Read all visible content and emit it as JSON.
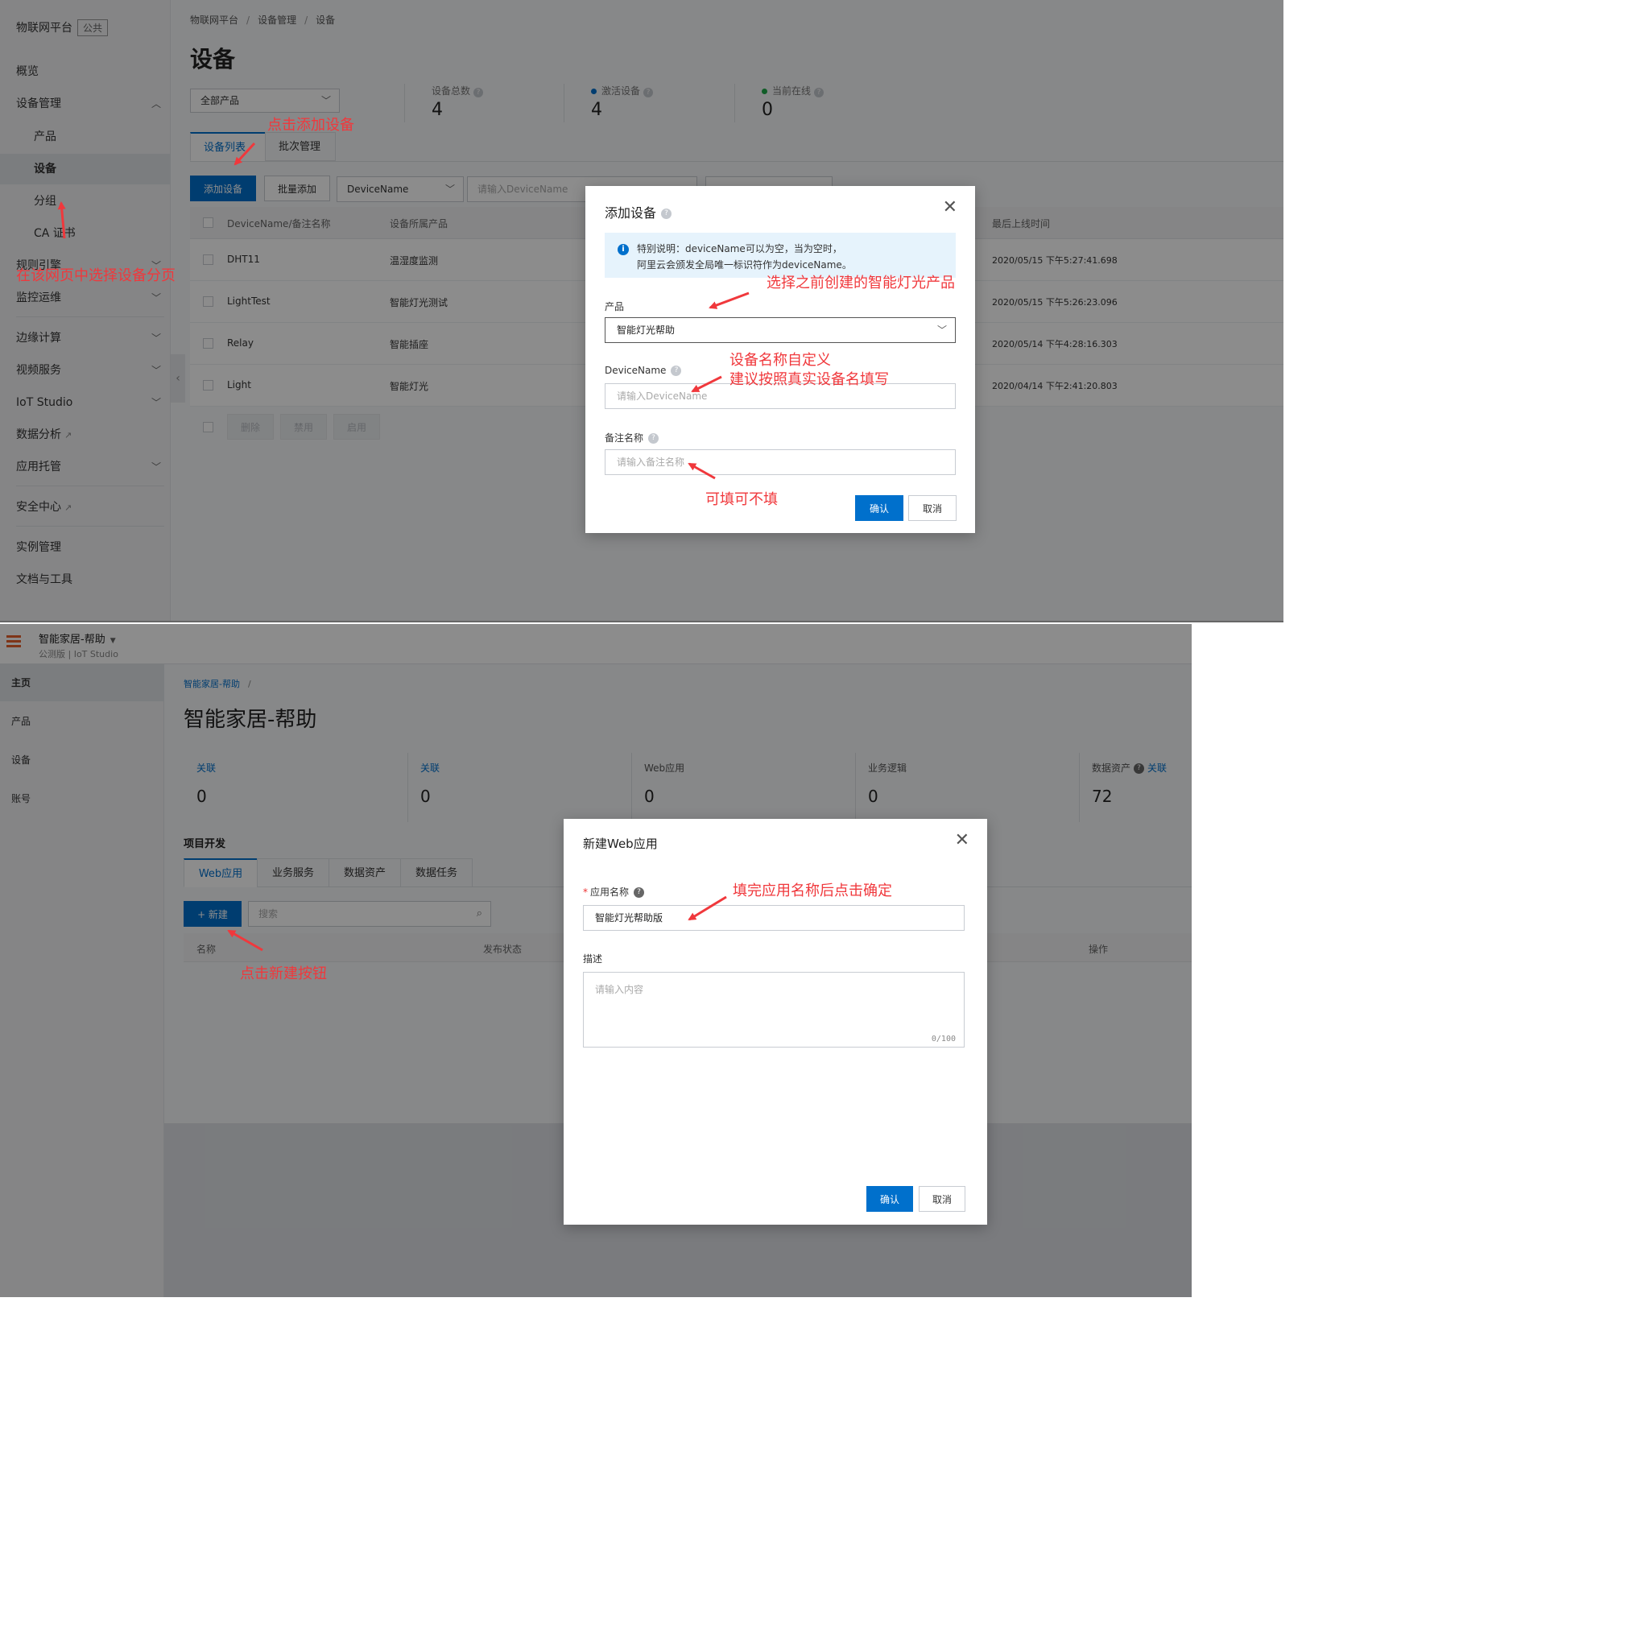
{
  "panel1": {
    "sidebar": {
      "brand": "物联网平台",
      "brand_tag": "公共",
      "items": [
        {
          "label": "概览"
        },
        {
          "label": "设备管理"
        },
        {
          "label": "产品"
        },
        {
          "label": "设备"
        },
        {
          "label": "分组"
        },
        {
          "label": "CA 证书"
        },
        {
          "label": "规则引擎"
        },
        {
          "label": "监控运维"
        },
        {
          "label": "边缘计算"
        },
        {
          "label": "视频服务"
        },
        {
          "label": "IoT Studio"
        },
        {
          "label": "数据分析"
        },
        {
          "label": "应用托管"
        },
        {
          "label": "安全中心"
        },
        {
          "label": "实例管理"
        },
        {
          "label": "文档与工具"
        }
      ]
    },
    "breadcrumb": [
      "物联网平台",
      "设备管理",
      "设备"
    ],
    "page_title": "设备",
    "product_filter": "全部产品",
    "stats": [
      {
        "label": "设备总数",
        "value": "4",
        "dot": ""
      },
      {
        "label": "激活设备",
        "value": "4",
        "dot": "#0070cc"
      },
      {
        "label": "当前在线",
        "value": "0",
        "dot": "#1fa94a"
      }
    ],
    "tabs": [
      "设备列表",
      "批次管理"
    ],
    "toolbar": {
      "add": "添加设备",
      "batch_add": "批量添加",
      "search_field": "DeviceName",
      "search_placeholder": "请输入DeviceName"
    },
    "table": {
      "headers": [
        "DeviceName/备注名称",
        "设备所属产品",
        "最后上线时间"
      ],
      "rows": [
        {
          "name": "DHT11",
          "product": "温湿度监测",
          "last": "2020/05/15 下午5:27:41.698"
        },
        {
          "name": "LightTest",
          "product": "智能灯光测试",
          "last": "2020/05/15 下午5:26:23.096"
        },
        {
          "name": "Relay",
          "product": "智能插座",
          "last": "2020/05/14 下午4:28:16.303"
        },
        {
          "name": "Light",
          "product": "智能灯光",
          "last": "2020/04/14 下午2:41:20.803"
        }
      ],
      "bulk": [
        "删除",
        "禁用",
        "启用"
      ]
    },
    "modal": {
      "title": "添加设备",
      "notice_line1": "特别说明：deviceName可以为空，当为空时，",
      "notice_line2": "阿里云会颁发全局唯一标识符作为deviceName。",
      "product_label": "产品",
      "product_value": "智能灯光帮助",
      "devicename_label": "DeviceName",
      "devicename_placeholder": "请输入DeviceName",
      "alias_label": "备注名称",
      "alias_placeholder": "请输入备注名称",
      "confirm": "确认",
      "cancel": "取消"
    },
    "annotations": {
      "click_add": "点击添加设备",
      "choose_page": "在该网页中选择设备分页",
      "choose_product": "选择之前创建的智能灯光产品",
      "name_custom_1": "设备名称自定义",
      "name_custom_2": "建议按照真实设备名填写",
      "optional": "可填可不填"
    }
  },
  "panel2": {
    "app_name": "智能家居-帮助",
    "app_sub": "公测版 | IoT Studio",
    "nav": [
      "主页",
      "产品",
      "设备",
      "账号"
    ],
    "breadcrumb": "智能家居-帮助",
    "page_title": "智能家居-帮助",
    "stats": [
      {
        "label": "关联",
        "value": "0"
      },
      {
        "label": "关联",
        "value": "0"
      },
      {
        "label": "Web应用",
        "value": "0"
      },
      {
        "label": "业务逻辑",
        "value": "0"
      },
      {
        "label": "数据资产",
        "link": "关联",
        "value": "72"
      }
    ],
    "section_title": "项目开发",
    "tabs": [
      "Web应用",
      "业务服务",
      "数据资产",
      "数据任务"
    ],
    "new_button": "+ 新建",
    "search_placeholder": "搜索",
    "table_headers": [
      "名称",
      "发布状态",
      "操作"
    ],
    "modal": {
      "title": "新建Web应用",
      "name_label": "应用名称",
      "name_value": "智能灯光帮助版",
      "desc_label": "描述",
      "desc_placeholder": "请输入内容",
      "counter": "0/100",
      "confirm": "确认",
      "cancel": "取消"
    },
    "annotations": {
      "fill_name": "填完应用名称后点击确定",
      "click_new": "点击新建按钮"
    }
  },
  "colors": {
    "primary": "#0070cc",
    "annotation": "#f0383c",
    "overlay": "rgba(0,0,0,0.45)",
    "brand_orange": "#e8622c"
  }
}
